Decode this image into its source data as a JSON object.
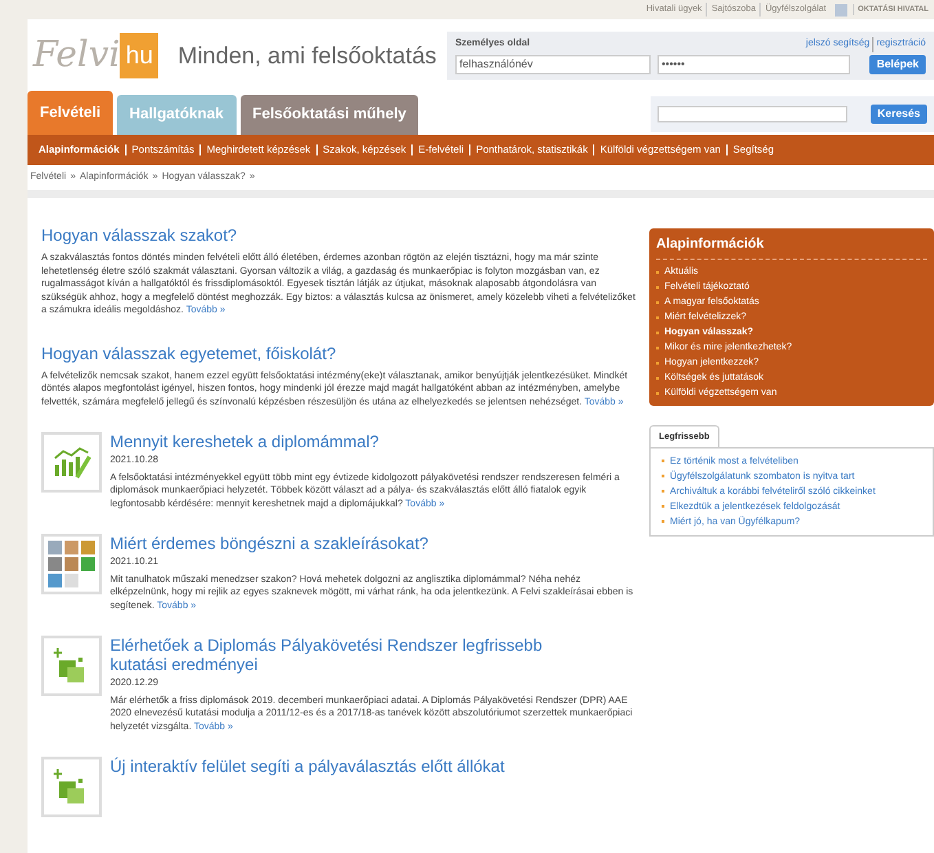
{
  "top_links": [
    "Hivatali ügyek",
    "Sajtószoba",
    "Ügyfélszolgálat"
  ],
  "agency": "OKTATÁSI HIVATAL",
  "logo": {
    "left": "Felvi",
    "right": "hu"
  },
  "slogan": "Minden, ami felsőoktatás",
  "login": {
    "title": "Személyes oldal",
    "links": [
      "jelszó segítség",
      "regisztráció"
    ],
    "username": "felhasználónév",
    "password": "••••••",
    "button": "Belépek"
  },
  "tabs": [
    {
      "label": "Felvételi",
      "selected": true,
      "color": "#e8792b"
    },
    {
      "label": "Hallgatóknak",
      "selected": false,
      "color": "#8fbfd0"
    },
    {
      "label": "Felsőoktatási műhely",
      "selected": false,
      "color": "#8a7a74"
    }
  ],
  "search": {
    "button": "Keresés"
  },
  "nav": [
    {
      "label": "Alapinformációk",
      "selected": true
    },
    {
      "label": "Pontszámítás",
      "selected": false
    },
    {
      "label": "Meghirdetett képzések",
      "selected": false
    },
    {
      "label": "Szakok, képzések",
      "selected": false
    },
    {
      "label": "E-felvételi",
      "selected": false
    },
    {
      "label": "Ponthatárok, statisztikák",
      "selected": false
    },
    {
      "label": "Külföldi végzettségem van",
      "selected": false
    },
    {
      "label": "Segítség",
      "selected": false
    }
  ],
  "breadcrumb": [
    "Felvételi",
    "Alapinformációk",
    "Hogyan válasszak?"
  ],
  "breadcrumb_separator": "»",
  "articles": [
    {
      "kind": "intro",
      "title": "Hogyan válasszak szakot?",
      "text": "A szakválasztás fontos döntés minden felvételi előtt álló életében, érdemes azonban rögtön az elején tisztázni, hogy ma már szinte lehetetlenség életre szóló szakmát választani. Gyorsan változik a világ, a gazdaság és munkaerőpiac is folyton mozgásban van, ez rugalmasságot kíván a hallgatóktól és frissdiplomásoktól. Egyesek tisztán látják az útjukat, másoknak alaposabb átgondolásra van szükségük ahhoz, hogy a megfelelő döntést meghozzák. Egy biztos: a választás kulcsa az önismeret, amely közelebb viheti a felvételizőket a számukra ideális megoldáshoz.",
      "more": "Tovább »"
    },
    {
      "kind": "intro",
      "title": "Hogyan válasszak egyetemet, főiskolát?",
      "text": "A felvételizők nemcsak szakot, hanem ezzel együtt felsőoktatási intézmény(eke)t választanak, amikor benyújtják jelentkezésüket. Mindkét döntés alapos megfontolást igényel, hiszen fontos, hogy mindenki jól érezze majd magát hallgatóként abban az intézményben, amelybe felvették, számára megfelelő jellegű és színvonalú képzésben részesüljön és utána az elhelyezkedés se jelentsen nehézséget.",
      "more": "Tovább »"
    },
    {
      "kind": "chart",
      "title": "Mennyit kereshetek a diplomámmal?",
      "date": "2021.10.28",
      "text": "A felsőoktatási intézményekkel együtt több mint egy évtizede kidolgozott pályakövetési rendszer rendszeresen felméri a diplomások munkaerőpiaci helyzetét. Többek között választ ad a pálya- és szakválasztás előtt álló fiatalok egyik legfontosabb kérdésére: mennyit kereshetnek majd a diplomájukkal?",
      "more": "Tovább »"
    },
    {
      "kind": "photos",
      "title": "Miért érdemes böngészni a szakleírásokat?",
      "date": "2021.10.21",
      "text": "Mit tanulhatok műszaki menedzser szakon? Hová mehetek dolgozni az anglisztika diplomámmal? Néha nehéz elképzelnünk, hogy mi rejlik az egyes szaknevek mögött, mi várhat ránk, ha oda jelentkezünk. A Felvi szakleírásai ebben is segítenek.",
      "more": "Tovább »"
    },
    {
      "kind": "squares",
      "title": "Elérhetőek a Diplomás Pályakövetési Rendszer legfrissebb kutatási eredményei",
      "date": "2020.12.29",
      "text": "Már elérhetők a friss diplomások 2019. decemberi munkaerőpiaci adatai. A Diplomás Pályakövetési Rendszer (DPR) AAE 2020 elnevezésű kutatási modulja a 2011/12-es és a 2017/18-as tanévek között abszolutóriumot szerzettek munkaerőpiaci helyzetét vizsgálta.",
      "more": "Tovább »"
    },
    {
      "kind": "squares",
      "title": "Új interaktív felület segíti a pályaválasztás előtt állókat"
    }
  ],
  "sidebar": {
    "title": "Alapinformációk",
    "items": [
      {
        "label": "Aktuális",
        "selected": false
      },
      {
        "label": "Felvételi tájékoztató",
        "selected": false
      },
      {
        "label": "A magyar felsőoktatás",
        "selected": false
      },
      {
        "label": "Miért felvételizzek?",
        "selected": false
      },
      {
        "label": "Hogyan válasszak?",
        "selected": true
      },
      {
        "label": "Mikor és mire jelentkezhetek?",
        "selected": false
      },
      {
        "label": "Hogyan jelentkezzek?",
        "selected": false
      },
      {
        "label": "Költségek és juttatások",
        "selected": false
      },
      {
        "label": "Külföldi végzettségem van",
        "selected": false
      }
    ]
  },
  "latest": {
    "tab": "Legfrissebb",
    "items": [
      "Ez történik most a felvételiben",
      "Ügyfélszolgálatunk szombaton is nyitva tart",
      "Archiváltuk a korábbi felvételiről szóló cikkeinket",
      "Elkezdtük a jelentkezések feldolgozását",
      "Miért jó, ha van Ügyfélkapum?"
    ]
  }
}
